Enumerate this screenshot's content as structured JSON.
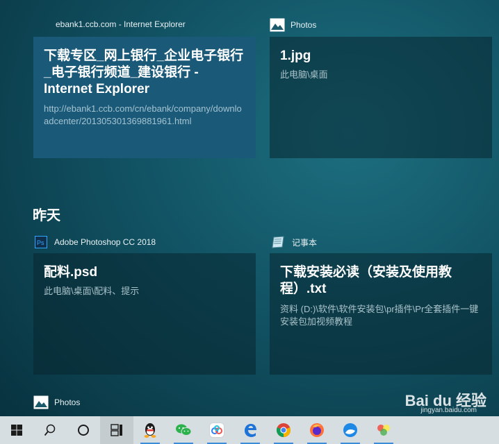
{
  "timeline": {
    "recent": [
      {
        "app": "ebank1.ccb.com - Internet Explorer",
        "title": "下载专区_网上银行_企业电子银行_电子银行频道_建设银行 - Internet Explorer",
        "subtitle": "http://ebank1.ccb.com/cn/ebank/company/downloadcenter/201305301369881961.html"
      },
      {
        "app": "Photos",
        "title": "1.jpg",
        "subtitle": "此电脑\\桌面"
      }
    ],
    "section_title": "昨天",
    "yesterday": [
      {
        "app": "Adobe Photoshop CC 2018",
        "title": "配料.psd",
        "subtitle": "此电脑\\桌面\\配料、提示"
      },
      {
        "app": "记事本",
        "title": "下载安装必读（安装及使用教程）.txt",
        "subtitle": "资料 (D:)\\软件\\软件安装包\\pr插件\\Pr全套插件一键安装包加视频教程"
      }
    ],
    "next_app": "Photos"
  },
  "watermark": {
    "brand": "Bai du 经验",
    "domain": "jingyan.baidu.com"
  },
  "taskbar": [
    {
      "icon": "windows-start-icon"
    },
    {
      "icon": "search-icon"
    },
    {
      "icon": "cortana-icon"
    },
    {
      "icon": "task-view-icon"
    },
    {
      "icon": "qq-icon"
    },
    {
      "icon": "wechat-icon"
    },
    {
      "icon": "baidu-netdisk-icon"
    },
    {
      "icon": "edge-icon"
    },
    {
      "icon": "chrome-icon"
    },
    {
      "icon": "firefox-icon"
    },
    {
      "icon": "browser-icon"
    },
    {
      "icon": "photos-app-icon"
    }
  ],
  "colors": {
    "selected_card": "#1a5a78",
    "taskbar": "#d7dee2",
    "accent": "#3c8dd8"
  }
}
